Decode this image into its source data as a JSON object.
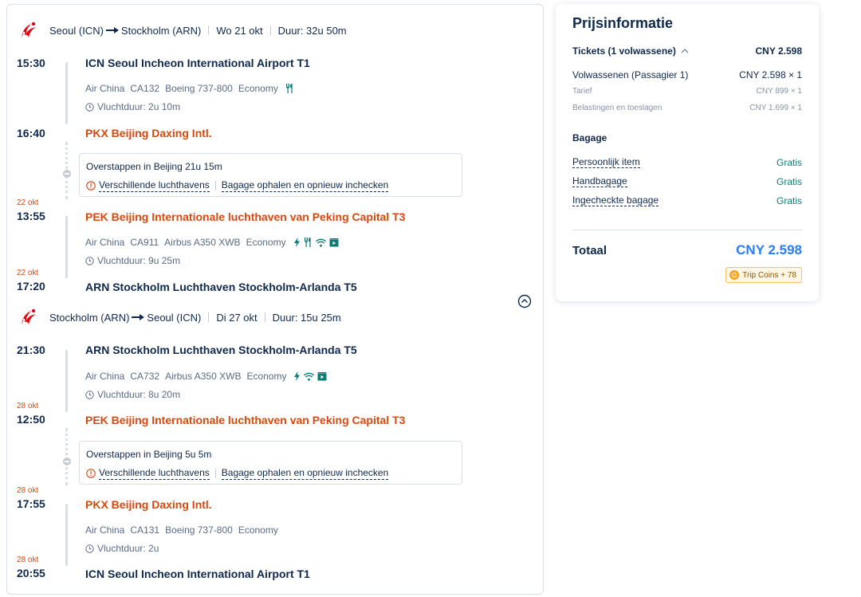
{
  "outbound": {
    "header": {
      "route_from": "Seoul (ICN)",
      "route_to": "Stockholm (ARN)",
      "date": "Wo 21 okt",
      "duration": "Duur: 32u 50m"
    },
    "seg1": {
      "dep_time": "15:30",
      "dep_airport": "ICN Seoul Incheon International Airport T1",
      "airline": "Air China",
      "flight": "CA132",
      "aircraft": "Boeing 737-800",
      "cabin": "Economy",
      "flight_duration": "Vluchtduur: 2u 10m",
      "arr_time": "16:40",
      "arr_airport": "PKX Beijing Daxing Intl."
    },
    "layover": {
      "title": "Overstappen in Beijing  21u 15m",
      "warning": "Verschillende luchthavens",
      "note": "Bagage ophalen en opnieuw inchecken"
    },
    "seg2": {
      "dep_date": "22 okt",
      "dep_time": "13:55",
      "dep_airport": "PEK Beijing Internationale luchthaven van Peking Capital T3",
      "airline": "Air China",
      "flight": "CA911",
      "aircraft": "Airbus A350 XWB",
      "cabin": "Economy",
      "flight_duration": "Vluchtduur: 9u 25m",
      "arr_date": "22 okt",
      "arr_time": "17:20",
      "arr_airport": "ARN Stockholm Luchthaven Stockholm-Arlanda T5"
    }
  },
  "return": {
    "header": {
      "route_from": "Stockholm (ARN)",
      "route_to": "Seoul (ICN)",
      "date": "Di 27 okt",
      "duration": "Duur: 15u 25m"
    },
    "seg1": {
      "dep_time": "21:30",
      "dep_airport": "ARN Stockholm Luchthaven Stockholm-Arlanda T5",
      "airline": "Air China",
      "flight": "CA732",
      "aircraft": "Airbus A350 XWB",
      "cabin": "Economy",
      "flight_duration": "Vluchtduur: 8u 20m",
      "arr_date": "28 okt",
      "arr_time": "12:50",
      "arr_airport": "PEK Beijing Internationale luchthaven van Peking Capital T3"
    },
    "layover": {
      "title": "Overstappen in Beijing  5u 5m",
      "warning": "Verschillende luchthavens",
      "note": "Bagage ophalen en opnieuw inchecken"
    },
    "seg2": {
      "dep_date": "28 okt",
      "dep_time": "17:55",
      "dep_airport": "PKX Beijing Daxing Intl.",
      "airline": "Air China",
      "flight": "CA131",
      "aircraft": "Boeing 737-800",
      "cabin": "Economy",
      "flight_duration": "Vluchtduur: 2u",
      "arr_date": "28 okt",
      "arr_time": "20:55",
      "arr_airport": "ICN Seoul Incheon International Airport T1"
    }
  },
  "price": {
    "title": "Prijsinformatie",
    "tickets_label": "Tickets (1 volwassene)",
    "tickets_total": "CNY 2.598",
    "adult_label": "Volwassenen (Passagier 1)",
    "adult_value": "CNY 2.598 × 1",
    "fare_label": "Tarief",
    "fare_value": "CNY 899 × 1",
    "tax_label": "Belastingen en toeslagen",
    "tax_value": "CNY 1.699 × 1",
    "baggage_title": "Bagage",
    "baggage": [
      {
        "label": "Persoonlijk item",
        "value": "Gratis"
      },
      {
        "label": "Handbagage",
        "value": "Gratis"
      },
      {
        "label": "Ingecheckte bagage",
        "value": "Gratis"
      }
    ],
    "total_label": "Totaal",
    "total_value": "CNY 2.598",
    "coins": "Trip Coins + 78"
  },
  "colors": {
    "accent": "#287dfa",
    "orange": "#d9480f",
    "green": "#0b7c75",
    "brand_red": "#e30613"
  },
  "icons": [
    "air-china-logo-icon",
    "clock-icon",
    "meal-icon",
    "power-icon",
    "wifi-icon",
    "entertainment-icon",
    "warning-icon",
    "chevron-up-icon",
    "collapse-circle-icon",
    "coin-icon"
  ]
}
